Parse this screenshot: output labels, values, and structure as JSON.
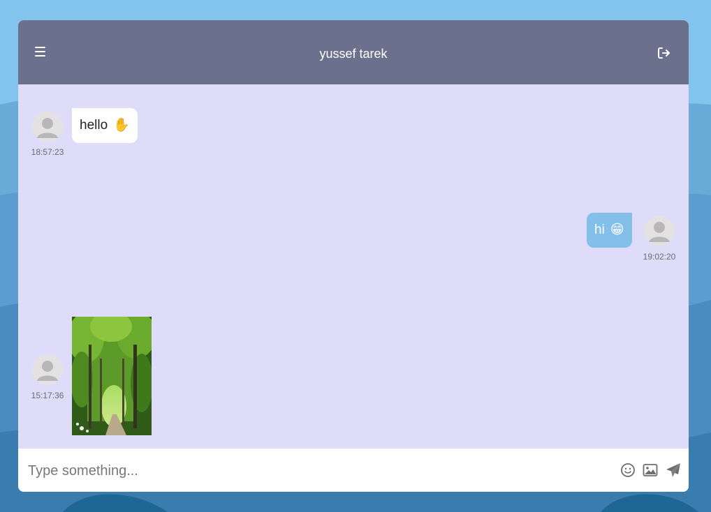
{
  "header": {
    "title": "yussef tarek",
    "menu_icon": "hamburger-menu-icon",
    "logout_icon": "logout-icon"
  },
  "messages": [
    {
      "direction": "incoming",
      "type": "text",
      "text": "hello",
      "emoji": "✋",
      "time": "18:57:23"
    },
    {
      "direction": "outgoing",
      "type": "text",
      "text": "hi",
      "emoji": "😁",
      "time": "19:02:20"
    },
    {
      "direction": "incoming",
      "type": "image",
      "image": "forest-path-photo",
      "time": "15:17:36"
    }
  ],
  "composer": {
    "placeholder": "Type something...",
    "emoji_icon": "smiley-icon",
    "image_icon": "image-icon",
    "send_icon": "send-icon"
  },
  "colors": {
    "page_background": "#7fc3ec",
    "header": "#6b718c",
    "chat_area": "#dedcf8",
    "incoming_bubble": "#ffffff",
    "outgoing_bubble": "#82c0ea"
  }
}
